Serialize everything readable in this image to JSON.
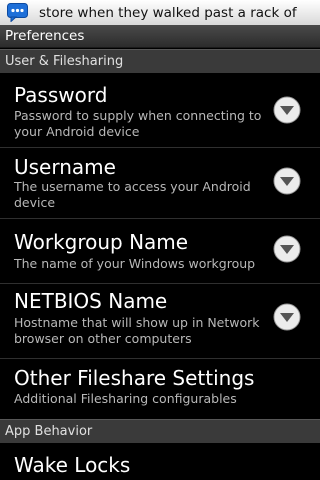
{
  "status_bar": {
    "ticker_text": "store when they walked past a rack of",
    "notification_icon": "chat-bubble-icon",
    "background_color": "#ffffff",
    "icon_color": "#1e6fd8"
  },
  "title_bar": {
    "title": "Preferences"
  },
  "categories": {
    "user_filesharing": "User & Filesharing",
    "app_behavior": "App Behavior"
  },
  "preferences": [
    {
      "title": "Password",
      "summary": "Password to supply when connecting to your Android device",
      "icon": "dropdown-arrow-icon"
    },
    {
      "title": "Username",
      "summary": "The username to access your Android device",
      "icon": "dropdown-arrow-icon"
    },
    {
      "title": "Workgroup Name",
      "summary": "The name of your Windows workgroup",
      "icon": "dropdown-arrow-icon"
    },
    {
      "title": "NETBIOS Name",
      "summary": "Hostname that will show up in Network browser on other computers",
      "icon": "dropdown-arrow-icon"
    },
    {
      "title": "Other Fileshare Settings",
      "summary": "Additional Filesharing configurables"
    },
    {
      "title": "Wake Locks"
    }
  ]
}
